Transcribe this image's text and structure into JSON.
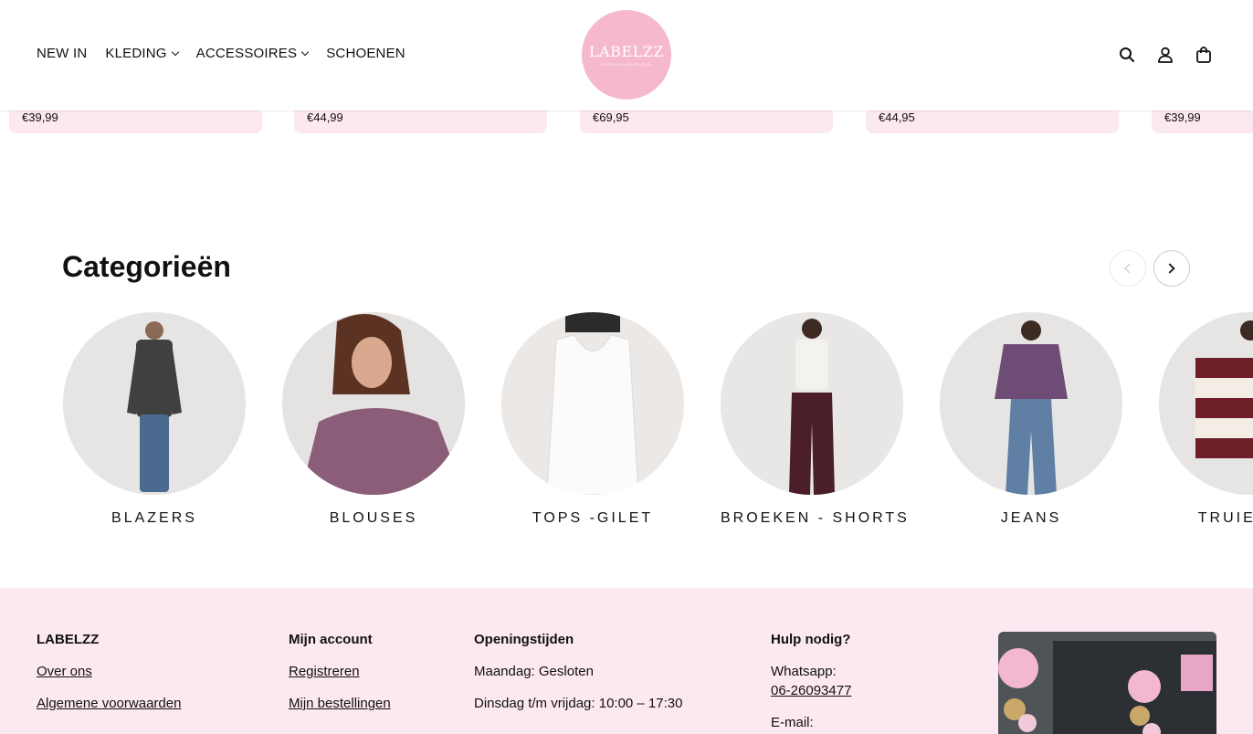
{
  "header": {
    "nav": [
      {
        "label": "NEW IN",
        "has_dropdown": false
      },
      {
        "label": "KLEDING",
        "has_dropdown": true
      },
      {
        "label": "ACCESSOIRES",
        "has_dropdown": true
      },
      {
        "label": "SCHOENEN",
        "has_dropdown": false
      }
    ],
    "logo": {
      "text": "LABELZZ",
      "subtext": "FASHION BOUTIQUE"
    },
    "icons": [
      "search-icon",
      "account-icon",
      "bag-icon"
    ]
  },
  "products": [
    {
      "price": "€39,99"
    },
    {
      "price": "€44,99"
    },
    {
      "price": "€69,95"
    },
    {
      "price": "€44,95"
    },
    {
      "price": "€39,99"
    }
  ],
  "categories": {
    "title": "Categorieën",
    "items": [
      {
        "label": "BLAZERS"
      },
      {
        "label": "BLOUSES"
      },
      {
        "label": "TOPS -GILET"
      },
      {
        "label": "BROEKEN - SHORTS"
      },
      {
        "label": "JEANS"
      },
      {
        "label": "TRUIEN - S"
      }
    ]
  },
  "footer": {
    "col1": {
      "heading": "LABELZZ",
      "links": [
        "Over ons",
        "Algemene voorwaarden"
      ]
    },
    "col2": {
      "heading": "Mijn account",
      "links": [
        "Registreren",
        "Mijn bestellingen"
      ]
    },
    "col3": {
      "heading": "Openingstijden",
      "lines": [
        "Maandag: Gesloten",
        "Dinsdag t/m vrijdag: 10:00 – 17:30"
      ]
    },
    "col4": {
      "heading": "Hulp nodig?",
      "whatsapp_label": "Whatsapp:",
      "whatsapp_number": "06-26093477",
      "email_label": "E-mail:"
    }
  },
  "colors": {
    "accent_pink": "#f6b8cf",
    "footer_bg": "#fce8f1"
  }
}
